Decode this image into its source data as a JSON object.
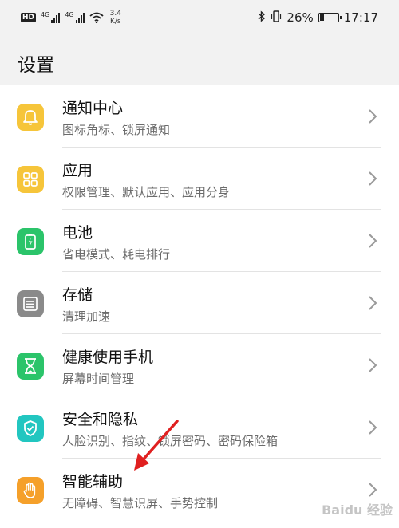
{
  "status_bar": {
    "hd_label": "HD",
    "network1": "4G",
    "network2": "4G",
    "speed_value": "3.4",
    "speed_unit": "K/s",
    "battery_percent": "26%",
    "battery_level": 0.26,
    "time": "17:17"
  },
  "header": {
    "title": "设置"
  },
  "colors": {
    "yellow": "#f6c53a",
    "green": "#2bc46a",
    "gray": "#8a8a8a",
    "teal": "#22c6c0",
    "orange": "#f5a02a",
    "arrow_red": "#e02020"
  },
  "items": [
    {
      "title": "通知中心",
      "subtitle": "图标角标、锁屏通知",
      "icon": "bell-icon"
    },
    {
      "title": "应用",
      "subtitle": "权限管理、默认应用、应用分身",
      "icon": "apps-grid-icon"
    },
    {
      "title": "电池",
      "subtitle": "省电模式、耗电排行",
      "icon": "battery-icon"
    },
    {
      "title": "存储",
      "subtitle": "清理加速",
      "icon": "storage-icon"
    },
    {
      "title": "健康使用手机",
      "subtitle": "屏幕时间管理",
      "icon": "hourglass-icon"
    },
    {
      "title": "安全和隐私",
      "subtitle": "人脸识别、指纹、锁屏密码、密码保险箱",
      "icon": "shield-icon"
    },
    {
      "title": "智能辅助",
      "subtitle": "无障碍、智慧识屏、手势控制",
      "icon": "hand-icon"
    }
  ],
  "watermark": "Baidu 经验"
}
